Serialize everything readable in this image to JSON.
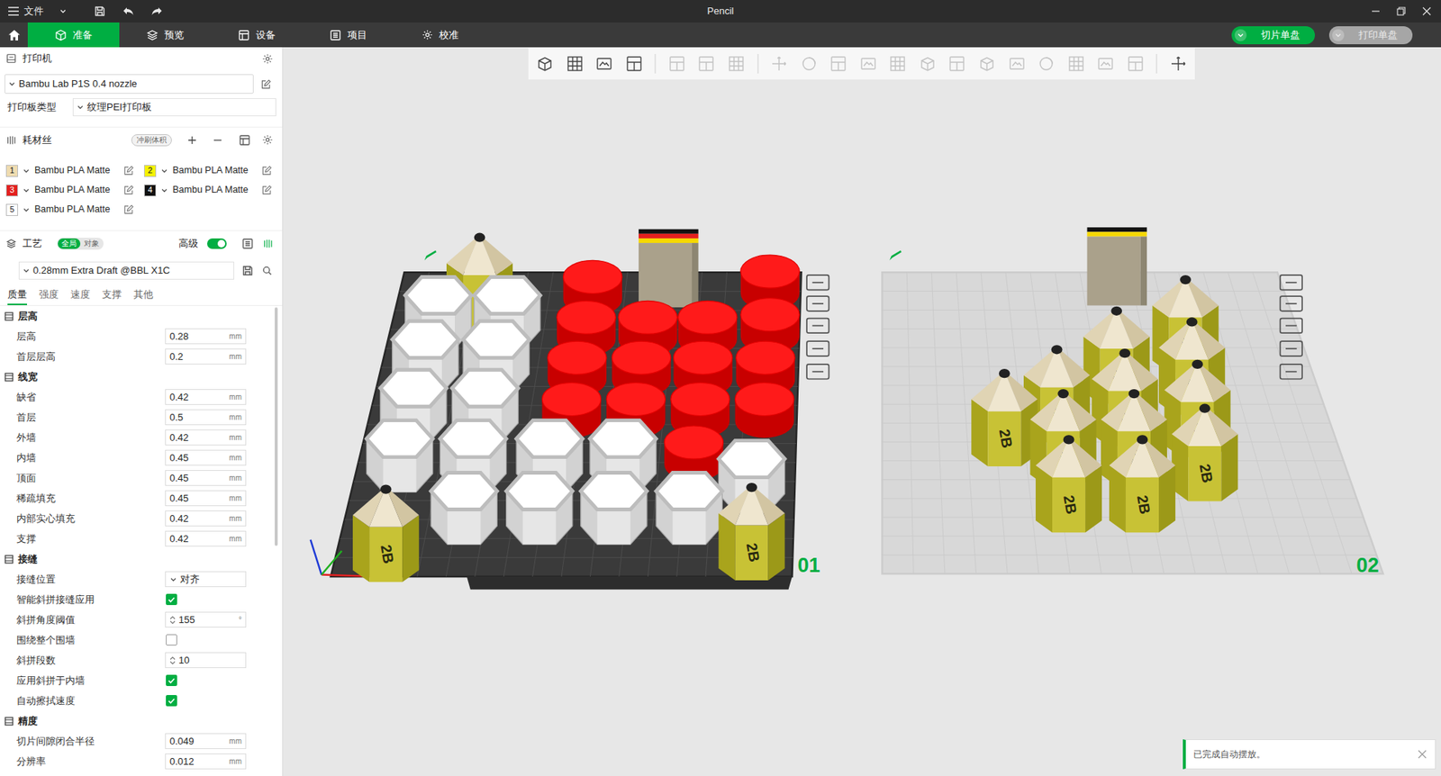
{
  "window": {
    "title": "Pencil",
    "menu": "文件"
  },
  "nav": {
    "tabs": [
      {
        "label": "准备",
        "selected": true
      },
      {
        "label": "预览",
        "selected": false
      },
      {
        "label": "设备",
        "selected": false
      },
      {
        "label": "项目",
        "selected": false
      },
      {
        "label": "校准",
        "selected": false
      }
    ]
  },
  "actions": [
    {
      "label": "切片单盘",
      "enabled": true
    },
    {
      "label": "打印单盘",
      "enabled": false
    }
  ],
  "printer": {
    "title": "打印机",
    "name": "Bambu Lab P1S 0.4 nozzle",
    "plate_type_label": "打印板类型",
    "plate_type": "纹理PEI打印板"
  },
  "filament": {
    "title": "耗材丝",
    "badge": "冲刷体积",
    "items": [
      {
        "index": "1",
        "name": "Bambu PLA Matte",
        "color": "#efdcb0"
      },
      {
        "index": "2",
        "name": "Bambu PLA Matte",
        "color": "#f5f200"
      },
      {
        "index": "3",
        "name": "Bambu PLA Matte",
        "color": "#e3201e"
      },
      {
        "index": "4",
        "name": "Bambu PLA Matte",
        "color": "#111111"
      },
      {
        "index": "5",
        "name": "Bambu PLA Matte",
        "color": "#ffffff"
      }
    ]
  },
  "process": {
    "title": "工艺",
    "scope": [
      {
        "label": "全局",
        "selected": true
      },
      {
        "label": "对象",
        "selected": false
      }
    ],
    "advanced_label": "高级",
    "advanced": true,
    "preset": "0.28mm Extra Draft @BBL X1C",
    "tabs": [
      {
        "label": "质量",
        "selected": true
      },
      {
        "label": "强度",
        "selected": false
      },
      {
        "label": "速度",
        "selected": false
      },
      {
        "label": "支撑",
        "selected": false
      },
      {
        "label": "其他",
        "selected": false
      }
    ],
    "sections": [
      {
        "title": "层高",
        "rows": [
          {
            "label": "层高",
            "kind": "number",
            "value": "0.28",
            "unit": "mm"
          },
          {
            "label": "首层层高",
            "kind": "number",
            "value": "0.2",
            "unit": "mm"
          }
        ]
      },
      {
        "title": "线宽",
        "rows": [
          {
            "label": "缺省",
            "kind": "number",
            "value": "0.42",
            "unit": "mm"
          },
          {
            "label": "首层",
            "kind": "number",
            "value": "0.5",
            "unit": "mm"
          },
          {
            "label": "外墙",
            "kind": "number",
            "value": "0.42",
            "unit": "mm"
          },
          {
            "label": "内墙",
            "kind": "number",
            "value": "0.45",
            "unit": "mm"
          },
          {
            "label": "顶面",
            "kind": "number",
            "value": "0.45",
            "unit": "mm"
          },
          {
            "label": "稀疏填充",
            "kind": "number",
            "value": "0.45",
            "unit": "mm"
          },
          {
            "label": "内部实心填充",
            "kind": "number",
            "value": "0.42",
            "unit": "mm"
          },
          {
            "label": "支撑",
            "kind": "number",
            "value": "0.42",
            "unit": "mm"
          }
        ]
      },
      {
        "title": "接缝",
        "rows": [
          {
            "label": "接缝位置",
            "kind": "select",
            "value": "对齐"
          },
          {
            "label": "智能斜拼接缝应用",
            "kind": "checkbox",
            "checked": true
          },
          {
            "label": "斜拼角度阈值",
            "kind": "spinner",
            "value": "155",
            "unit": "°"
          },
          {
            "label": "围绕整个围墙",
            "kind": "checkbox",
            "checked": false
          },
          {
            "label": "斜拼段数",
            "kind": "spinner",
            "value": "10"
          },
          {
            "label": "应用斜拼于内墙",
            "kind": "checkbox",
            "checked": true
          },
          {
            "label": "自动擦拭速度",
            "kind": "checkbox",
            "checked": true
          }
        ]
      },
      {
        "title": "精度",
        "rows": [
          {
            "label": "切片间隙闭合半径",
            "kind": "number",
            "value": "0.049",
            "unit": "mm"
          },
          {
            "label": "分辨率",
            "kind": "number",
            "value": "0.012",
            "unit": "mm"
          }
        ]
      }
    ]
  },
  "plates": [
    {
      "label": "01",
      "selected": true,
      "objects": [
        {
          "kind": "hexagon"
        },
        {
          "kind": "hexagon"
        },
        {
          "kind": "hexagon"
        },
        {
          "kind": "hexagon"
        },
        {
          "kind": "hexagon"
        },
        {
          "kind": "hexagon"
        },
        {
          "kind": "hexagon"
        },
        {
          "kind": "hexagon"
        },
        {
          "kind": "hexagon"
        },
        {
          "kind": "hexagon"
        },
        {
          "kind": "hexagon"
        },
        {
          "kind": "hexagon"
        },
        {
          "kind": "hexagon"
        },
        {
          "kind": "hexagon"
        },
        {
          "kind": "hexagon"
        },
        {
          "kind": "cylinder"
        },
        {
          "kind": "cylinder"
        },
        {
          "kind": "cylinder"
        },
        {
          "kind": "cylinder"
        },
        {
          "kind": "cylinder"
        },
        {
          "kind": "cylinder"
        },
        {
          "kind": "cylinder"
        },
        {
          "kind": "cylinder"
        },
        {
          "kind": "cylinder"
        },
        {
          "kind": "cylinder"
        },
        {
          "kind": "cylinder"
        },
        {
          "kind": "cylinder"
        },
        {
          "kind": "cylinder"
        },
        {
          "kind": "cylinder"
        },
        {
          "kind": "cylinder"
        },
        {
          "kind": "pencil",
          "label": "2B"
        },
        {
          "kind": "pencil",
          "label": "2B"
        },
        {
          "kind": "pencil",
          "label": "2B"
        },
        {
          "kind": "tower",
          "stripes": [
            "#111111",
            "#e3201e",
            "#f5d800"
          ]
        }
      ]
    },
    {
      "label": "02",
      "selected": false,
      "objects": [
        {
          "kind": "pencil",
          "label": "2B"
        },
        {
          "kind": "pencil",
          "label": "2B"
        },
        {
          "kind": "pencil",
          "label": "2B"
        },
        {
          "kind": "pencil",
          "label": "2B"
        },
        {
          "kind": "pencil",
          "label": "2B"
        },
        {
          "kind": "pencil",
          "label": "2B"
        },
        {
          "kind": "pencil",
          "label": "2B"
        },
        {
          "kind": "pencil",
          "label": "2B"
        },
        {
          "kind": "pencil",
          "label": "2B"
        },
        {
          "kind": "pencil",
          "label": "2B"
        },
        {
          "kind": "pencil",
          "label": "2B"
        },
        {
          "kind": "pencil",
          "label": "2B"
        },
        {
          "kind": "tower",
          "stripes": [
            "#111111",
            "#f5d800"
          ]
        }
      ]
    }
  ],
  "notification": "已完成自动摆放。"
}
